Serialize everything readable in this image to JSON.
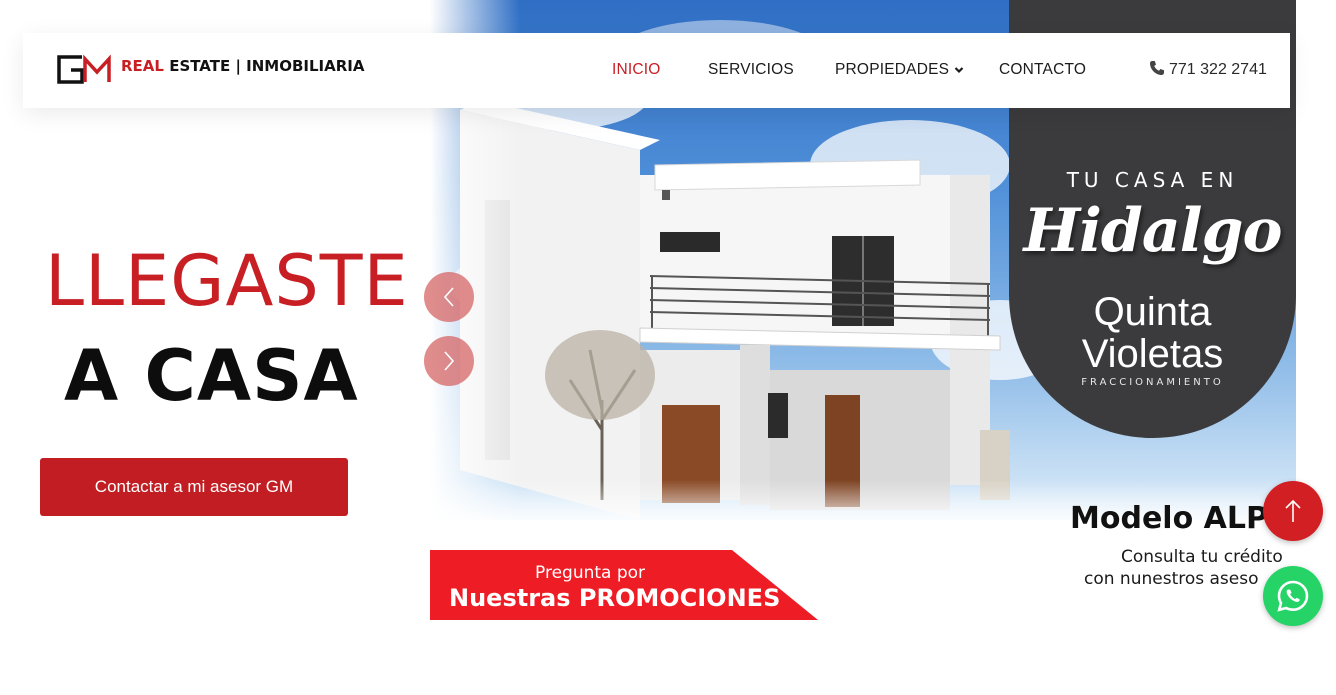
{
  "header": {
    "brand_red": "REAL",
    "brand_rest": " ESTATE | INMOBILIARIA",
    "nav": [
      {
        "label": "INICIO",
        "active": true
      },
      {
        "label": "SERVICIOS",
        "active": false
      },
      {
        "label": "PROPIEDADES",
        "active": false,
        "has_dropdown": true
      },
      {
        "label": "CONTACTO",
        "active": false
      }
    ],
    "phone": "771 322 2741",
    "phone_icon": "phone-icon"
  },
  "hero": {
    "line1": "LLEGASTE",
    "line2": "A CASA",
    "cta_label": "Contactar a mi asesor GM"
  },
  "banner": {
    "kicker": "TU CASA EN",
    "script_title": "Hidalgo",
    "name_line1": "Quinta",
    "name_line2": "Violetas",
    "subtitle": "FRACCIONAMIENTO",
    "model": "Modelo ALPH",
    "credit_line1": "Consulta tu crédito",
    "credit_line2": "con nunestros aseso",
    "promo_line1": "Pregunta por",
    "promo_line2": "Nuestras PROMOCIONES"
  },
  "slider": {
    "prev_icon": "chevron-left-icon",
    "next_icon": "chevron-right-icon"
  },
  "floating": {
    "to_top_icon": "arrow-up-icon",
    "whatsapp_icon": "whatsapp-icon"
  },
  "colors": {
    "brand_red": "#c81f25",
    "button_red": "#c11d22",
    "promo_red": "#ee1c25",
    "panel_dark": "#3b3b3d",
    "whatsapp_green": "#25d366"
  }
}
